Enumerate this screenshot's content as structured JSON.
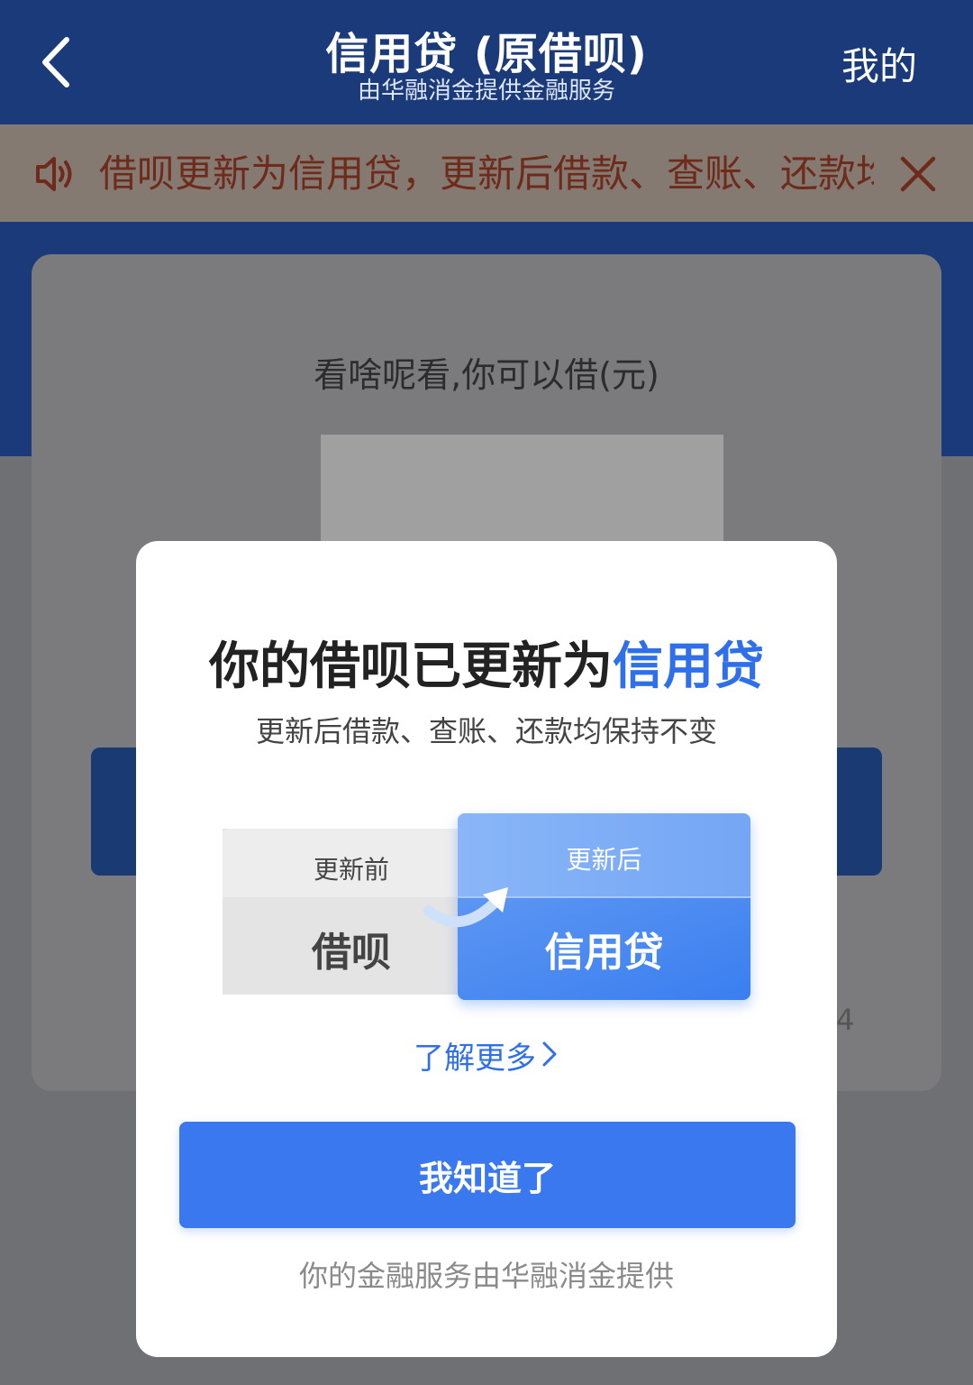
{
  "header": {
    "title": "信用贷 (原借呗)",
    "subtitle": "由华融消金提供金融服务",
    "mine_label": "我的"
  },
  "notice": {
    "text": "借呗更新为信用贷，更新后借款、查账、还款均保持不变"
  },
  "card": {
    "label": "看啥呢看,你可以借(元)",
    "partial_digit": "4"
  },
  "modal": {
    "title_prefix": "你的借呗已更新为",
    "title_highlight": "信用贷",
    "subtitle": "更新后借款、查账、还款均保持不变",
    "before_label": "更新前",
    "before_value": "借呗",
    "after_label": "更新后",
    "after_value": "信用贷",
    "learn_more": "了解更多",
    "confirm_button": "我知道了",
    "footer_note": "你的金融服务由华融消金提供"
  },
  "colors": {
    "header_bg": "#1a3a7a",
    "accent_blue": "#2f6fe9",
    "button_blue": "#3a78ef"
  },
  "icons": {
    "back": "chevron-left-icon",
    "speaker": "speaker-icon",
    "close": "close-icon",
    "arrow": "curved-arrow-icon",
    "chevron": "chevron-right-icon"
  }
}
